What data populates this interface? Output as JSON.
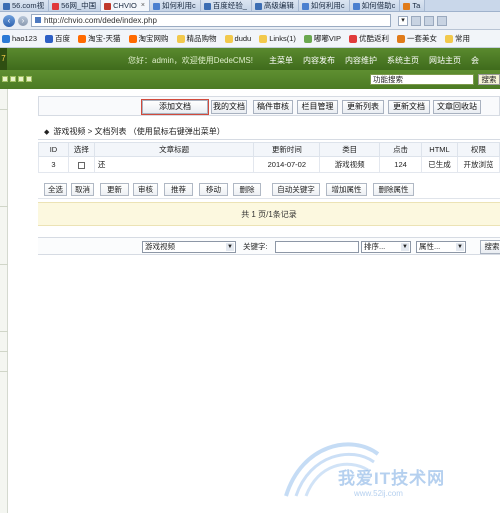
{
  "browser": {
    "tabs": [
      {
        "label": "56.com视",
        "color": "#3b6db3",
        "active": false
      },
      {
        "label": "56网_中国",
        "color": "#e0383b",
        "active": false
      },
      {
        "label": "CHVIO",
        "color": "#c0392b",
        "active": true
      },
      {
        "label": "如何利用c",
        "color": "#4a7fcf",
        "active": false
      },
      {
        "label": "百度经验_",
        "color": "#3b6db3",
        "active": false
      },
      {
        "label": "高级编辑",
        "color": "#3b6db3",
        "active": false
      },
      {
        "label": "如何利用c",
        "color": "#4a7fcf",
        "active": false
      },
      {
        "label": "如何借助c",
        "color": "#4a7fcf",
        "active": false
      },
      {
        "label": "Ta",
        "color": "#e07b1a",
        "active": false
      }
    ],
    "url": "http://chvio.com/dede/index.php",
    "favorites": [
      {
        "label": "hao123",
        "color": "#2c7ad6"
      },
      {
        "label": "百度",
        "color": "#2d5fc4"
      },
      {
        "label": "淘宝-天猫",
        "color": "#ff6a00"
      },
      {
        "label": "淘宝网购",
        "color": "#ff6a00"
      },
      {
        "label": "精品购物",
        "color": "#f2c94c"
      },
      {
        "label": "dudu",
        "color": "#f2c94c"
      },
      {
        "label": "Links(1)",
        "color": "#f2c94c"
      },
      {
        "label": "嘟嘟VIP",
        "color": "#6aa84f"
      },
      {
        "label": "优酷返利",
        "color": "#e03b3b"
      },
      {
        "label": "一套美女",
        "color": "#e07b1a"
      },
      {
        "label": "常用",
        "color": "#f2c94c"
      }
    ]
  },
  "cms": {
    "corner_glyph": "7",
    "welcome": "您好：admin，欢迎使用DedeCMS!",
    "menu": [
      "主菜单",
      "内容发布",
      "内容维护",
      "系统主页",
      "网站主页",
      "会"
    ],
    "func_search_value": "功能搜索",
    "func_search_button": "搜索"
  },
  "toolbar": {
    "buttons": [
      "添加文档",
      "我的文档",
      "稿件审核",
      "栏目管理",
      "更新列表",
      "更新文档",
      "文章回收站"
    ]
  },
  "breadcrumb": {
    "glyph": "◆",
    "text": "游戏视频 > 文档列表 （使用鼠标右键弹出菜单）"
  },
  "table": {
    "headers": [
      "ID",
      "选择",
      "文章标题",
      "更新时间",
      "类目",
      "点击",
      "HTML",
      "权限"
    ],
    "rows": [
      {
        "id": "3",
        "title": "还",
        "updated": "2014-07-02",
        "category": "游戏视频",
        "clicks": "124",
        "html": "已生成",
        "permission": "开放浏览"
      }
    ]
  },
  "actions": [
    "全选",
    "取消",
    "更新",
    "审核",
    "推荐",
    "移动",
    "删除",
    "自动关键字",
    "增加属性",
    "删除属性"
  ],
  "pager": {
    "text": "共 1 页/1条记录"
  },
  "filter": {
    "category_select": "游戏视频",
    "keyword_label": "关键字:",
    "sort_select": "排序...",
    "attr_select": "属性...",
    "search_button": "搜索"
  },
  "watermark": {
    "text": "我爱IT技术网",
    "url": "www.52ij.com"
  }
}
